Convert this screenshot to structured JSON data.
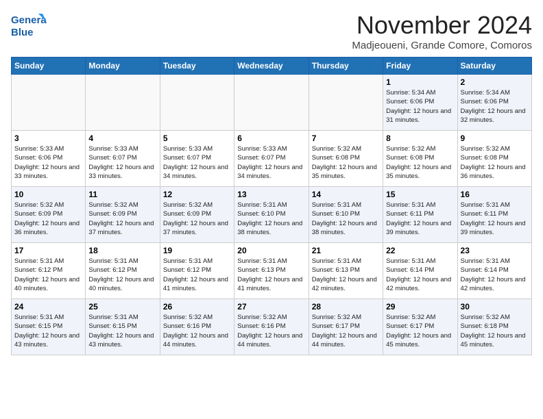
{
  "header": {
    "logo_line1": "General",
    "logo_line2": "Blue",
    "month": "November 2024",
    "location": "Madjeoueni, Grande Comore, Comoros"
  },
  "days_of_week": [
    "Sunday",
    "Monday",
    "Tuesday",
    "Wednesday",
    "Thursday",
    "Friday",
    "Saturday"
  ],
  "weeks": [
    [
      {
        "day": "",
        "info": ""
      },
      {
        "day": "",
        "info": ""
      },
      {
        "day": "",
        "info": ""
      },
      {
        "day": "",
        "info": ""
      },
      {
        "day": "",
        "info": ""
      },
      {
        "day": "1",
        "info": "Sunrise: 5:34 AM\nSunset: 6:06 PM\nDaylight: 12 hours and 31 minutes."
      },
      {
        "day": "2",
        "info": "Sunrise: 5:34 AM\nSunset: 6:06 PM\nDaylight: 12 hours and 32 minutes."
      }
    ],
    [
      {
        "day": "3",
        "info": "Sunrise: 5:33 AM\nSunset: 6:06 PM\nDaylight: 12 hours and 33 minutes."
      },
      {
        "day": "4",
        "info": "Sunrise: 5:33 AM\nSunset: 6:07 PM\nDaylight: 12 hours and 33 minutes."
      },
      {
        "day": "5",
        "info": "Sunrise: 5:33 AM\nSunset: 6:07 PM\nDaylight: 12 hours and 34 minutes."
      },
      {
        "day": "6",
        "info": "Sunrise: 5:33 AM\nSunset: 6:07 PM\nDaylight: 12 hours and 34 minutes."
      },
      {
        "day": "7",
        "info": "Sunrise: 5:32 AM\nSunset: 6:08 PM\nDaylight: 12 hours and 35 minutes."
      },
      {
        "day": "8",
        "info": "Sunrise: 5:32 AM\nSunset: 6:08 PM\nDaylight: 12 hours and 35 minutes."
      },
      {
        "day": "9",
        "info": "Sunrise: 5:32 AM\nSunset: 6:08 PM\nDaylight: 12 hours and 36 minutes."
      }
    ],
    [
      {
        "day": "10",
        "info": "Sunrise: 5:32 AM\nSunset: 6:09 PM\nDaylight: 12 hours and 36 minutes."
      },
      {
        "day": "11",
        "info": "Sunrise: 5:32 AM\nSunset: 6:09 PM\nDaylight: 12 hours and 37 minutes."
      },
      {
        "day": "12",
        "info": "Sunrise: 5:32 AM\nSunset: 6:09 PM\nDaylight: 12 hours and 37 minutes."
      },
      {
        "day": "13",
        "info": "Sunrise: 5:31 AM\nSunset: 6:10 PM\nDaylight: 12 hours and 38 minutes."
      },
      {
        "day": "14",
        "info": "Sunrise: 5:31 AM\nSunset: 6:10 PM\nDaylight: 12 hours and 38 minutes."
      },
      {
        "day": "15",
        "info": "Sunrise: 5:31 AM\nSunset: 6:11 PM\nDaylight: 12 hours and 39 minutes."
      },
      {
        "day": "16",
        "info": "Sunrise: 5:31 AM\nSunset: 6:11 PM\nDaylight: 12 hours and 39 minutes."
      }
    ],
    [
      {
        "day": "17",
        "info": "Sunrise: 5:31 AM\nSunset: 6:12 PM\nDaylight: 12 hours and 40 minutes."
      },
      {
        "day": "18",
        "info": "Sunrise: 5:31 AM\nSunset: 6:12 PM\nDaylight: 12 hours and 40 minutes."
      },
      {
        "day": "19",
        "info": "Sunrise: 5:31 AM\nSunset: 6:12 PM\nDaylight: 12 hours and 41 minutes."
      },
      {
        "day": "20",
        "info": "Sunrise: 5:31 AM\nSunset: 6:13 PM\nDaylight: 12 hours and 41 minutes."
      },
      {
        "day": "21",
        "info": "Sunrise: 5:31 AM\nSunset: 6:13 PM\nDaylight: 12 hours and 42 minutes."
      },
      {
        "day": "22",
        "info": "Sunrise: 5:31 AM\nSunset: 6:14 PM\nDaylight: 12 hours and 42 minutes."
      },
      {
        "day": "23",
        "info": "Sunrise: 5:31 AM\nSunset: 6:14 PM\nDaylight: 12 hours and 42 minutes."
      }
    ],
    [
      {
        "day": "24",
        "info": "Sunrise: 5:31 AM\nSunset: 6:15 PM\nDaylight: 12 hours and 43 minutes."
      },
      {
        "day": "25",
        "info": "Sunrise: 5:31 AM\nSunset: 6:15 PM\nDaylight: 12 hours and 43 minutes."
      },
      {
        "day": "26",
        "info": "Sunrise: 5:32 AM\nSunset: 6:16 PM\nDaylight: 12 hours and 44 minutes."
      },
      {
        "day": "27",
        "info": "Sunrise: 5:32 AM\nSunset: 6:16 PM\nDaylight: 12 hours and 44 minutes."
      },
      {
        "day": "28",
        "info": "Sunrise: 5:32 AM\nSunset: 6:17 PM\nDaylight: 12 hours and 44 minutes."
      },
      {
        "day": "29",
        "info": "Sunrise: 5:32 AM\nSunset: 6:17 PM\nDaylight: 12 hours and 45 minutes."
      },
      {
        "day": "30",
        "info": "Sunrise: 5:32 AM\nSunset: 6:18 PM\nDaylight: 12 hours and 45 minutes."
      }
    ]
  ]
}
